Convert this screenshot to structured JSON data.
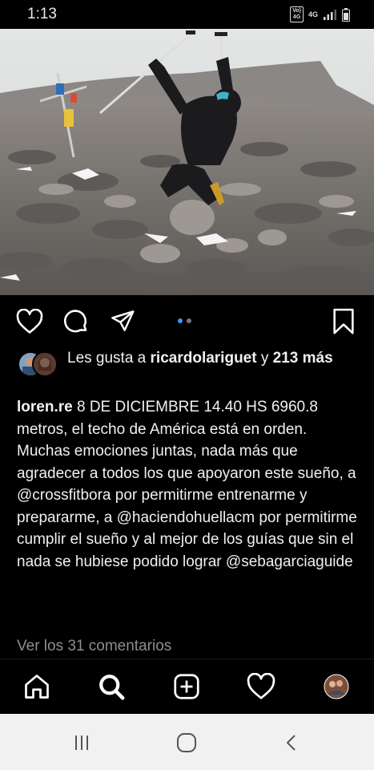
{
  "status_bar": {
    "time": "1:13",
    "volte_line1": "Vo)",
    "volte_line2": "4G",
    "network": "4G"
  },
  "post": {
    "image_icon": "mountain-summit-photo",
    "carousel": {
      "count": 2,
      "active_index": 0
    },
    "likes": {
      "prefix": "Les gusta a ",
      "user": "ricardolariguet",
      "middle": " y ",
      "count": "213",
      "suffix": "más"
    },
    "caption": {
      "username": "loren.re",
      "text": " 8 DE DICIEMBRE 14.40 HS 6960.8 metros, el techo de América está en orden. Muchas emociones juntas, nada más que agradecer a todos los que apoyaron este sueño, a @crossfitbora por permitirme entrenarme y prepararme, a @haciendohuellacm por permitirme cumplir el sueño y al mejor de los guías que sin el nada se hubiese podido lograr @sebagarciaguide"
    },
    "view_comments": "Ver los 31 comentarios"
  },
  "icons": {
    "like": "heart-icon",
    "comment": "comment-icon",
    "share": "send-icon",
    "save": "bookmark-icon",
    "home": "home-icon",
    "search": "search-icon",
    "new_post": "add-post-icon",
    "activity": "heart-icon",
    "profile": "profile-avatar"
  },
  "colors": {
    "background": "#000000",
    "text": "#f0f0f0",
    "muted": "#8e8e8e",
    "carousel_active": "#3a97f0",
    "system_nav": "#f1f1f1"
  }
}
